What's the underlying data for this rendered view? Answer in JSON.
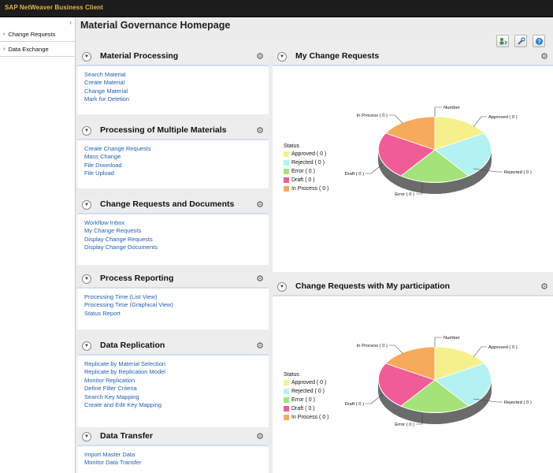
{
  "app": {
    "title": "SAP NetWeaver Business Client"
  },
  "nav": {
    "collapse_glyph": "‹",
    "items": [
      {
        "label": "Change Requests"
      },
      {
        "label": "Data Exchange"
      }
    ]
  },
  "page": {
    "title": "Material Governance Homepage"
  },
  "toolbar": {
    "icons": [
      "personalize-icon",
      "settings-icon",
      "help-icon"
    ]
  },
  "colors": {
    "approved": "#f6f08c",
    "rejected": "#b2f2f0",
    "error": "#a4e27a",
    "draft": "#f05c96",
    "in_process": "#f6ab5c",
    "link": "#1f5fb0",
    "header_bar": "#1c1c1c",
    "app_title": "#e8b44a"
  },
  "panels": [
    {
      "title": "Material Processing",
      "links": [
        "Search Material",
        "Create Material",
        "Change Material",
        "Mark for Deletion"
      ]
    },
    {
      "title": "Processing of Multiple Materials",
      "links": [
        "Create Change Requests",
        "Mass Change",
        "File Download",
        "File Upload"
      ]
    },
    {
      "title": "Change Requests and Documents",
      "links": [
        "Workflow Inbox",
        "My Change Requests",
        "Display Change Requests",
        "Display Change Documents"
      ]
    },
    {
      "title": "Process Reporting",
      "links": [
        "Processing Time (List View)",
        "Processing Time (Graphical View)",
        "Status Report"
      ]
    },
    {
      "title": "Data Replication",
      "links": [
        "Replicate by Material Selection",
        "Replicate by Replication Model",
        "Monitor Replication",
        "Define Filter Criteria",
        "Search Key Mapping",
        "Create and Edit Key Mapping"
      ]
    },
    {
      "title": "Data Transfer",
      "links": [
        "Import Master Data",
        "Monitor Data Transfer"
      ]
    }
  ],
  "chart_panels": [
    {
      "title": "My Change Requests",
      "legend_title": "Status",
      "legend": [
        "Approved ( 0 )",
        "Rejected ( 0 )",
        "Error ( 0 )",
        "Draft ( 0 )",
        "In Process ( 0 )"
      ],
      "labels": {
        "number": "Number",
        "approved": "Approved ( 0 )",
        "rejected": "Rejected ( 0 )",
        "error": "Error ( 0 )",
        "draft": "Draft ( 0 )",
        "in_process": "In Process ( 0 )"
      }
    },
    {
      "title": "Change Requests with My participation",
      "legend_title": "Status",
      "legend": [
        "Approved ( 0 )",
        "Rejected ( 0 )",
        "Error ( 0 )",
        "Draft ( 0 )",
        "In Process ( 0 )"
      ],
      "labels": {
        "number": "Number",
        "approved": "Approved ( 0 )",
        "rejected": "Rejected ( 0 )",
        "error": "Error ( 0 )",
        "draft": "Draft ( 0 )",
        "in_process": "In Process ( 0 )"
      }
    }
  ],
  "chart_data": [
    {
      "type": "pie",
      "title": "My Change Requests",
      "legend_title": "Status",
      "categories": [
        "Approved",
        "Rejected",
        "Error",
        "Draft",
        "In Process"
      ],
      "values": [
        0,
        0,
        0,
        0,
        0
      ],
      "colors": [
        "#f6f08c",
        "#b2f2f0",
        "#a4e27a",
        "#f05c96",
        "#f6ab5c"
      ],
      "legend_position": "left"
    },
    {
      "type": "pie",
      "title": "Change Requests with My participation",
      "legend_title": "Status",
      "categories": [
        "Approved",
        "Rejected",
        "Error",
        "Draft",
        "In Process"
      ],
      "values": [
        0,
        0,
        0,
        0,
        0
      ],
      "colors": [
        "#f6f08c",
        "#b2f2f0",
        "#a4e27a",
        "#f05c96",
        "#f6ab5c"
      ],
      "legend_position": "left"
    }
  ]
}
